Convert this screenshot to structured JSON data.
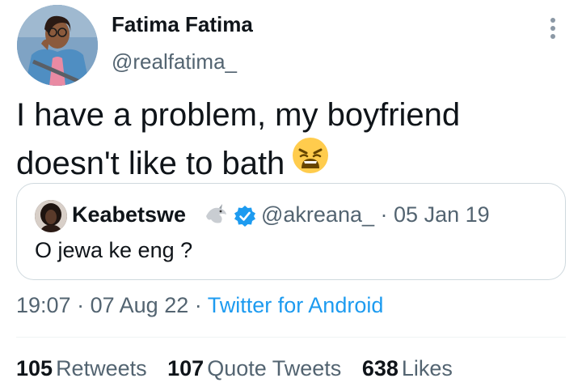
{
  "author": {
    "display_name": "Fatima Fatima",
    "handle": "@realfatima_"
  },
  "tweet": {
    "text": "I have a problem, my boyfriend doesn't like to bath",
    "emoji": "weary-face-emoji"
  },
  "quoted_tweet": {
    "display_name": "Keabetswe",
    "handle": "@akreana_",
    "separator": "·",
    "date": "05 Jan 19",
    "text": "O jewa ke eng ?",
    "verified": true
  },
  "meta": {
    "time": "19:07",
    "separator_1": "·",
    "date": "07 Aug 22",
    "separator_2": "·",
    "source": "Twitter for Android"
  },
  "stats": {
    "retweets_count": "105",
    "retweets_label": "Retweets",
    "quotes_count": "107",
    "quotes_label": "Quote Tweets",
    "likes_count": "638",
    "likes_label": "Likes"
  },
  "colors": {
    "text_primary": "#0f1419",
    "text_secondary": "#536471",
    "link_blue": "#1d9bf0",
    "border": "#cfd9de",
    "verified_blue": "#1d9bf0"
  }
}
